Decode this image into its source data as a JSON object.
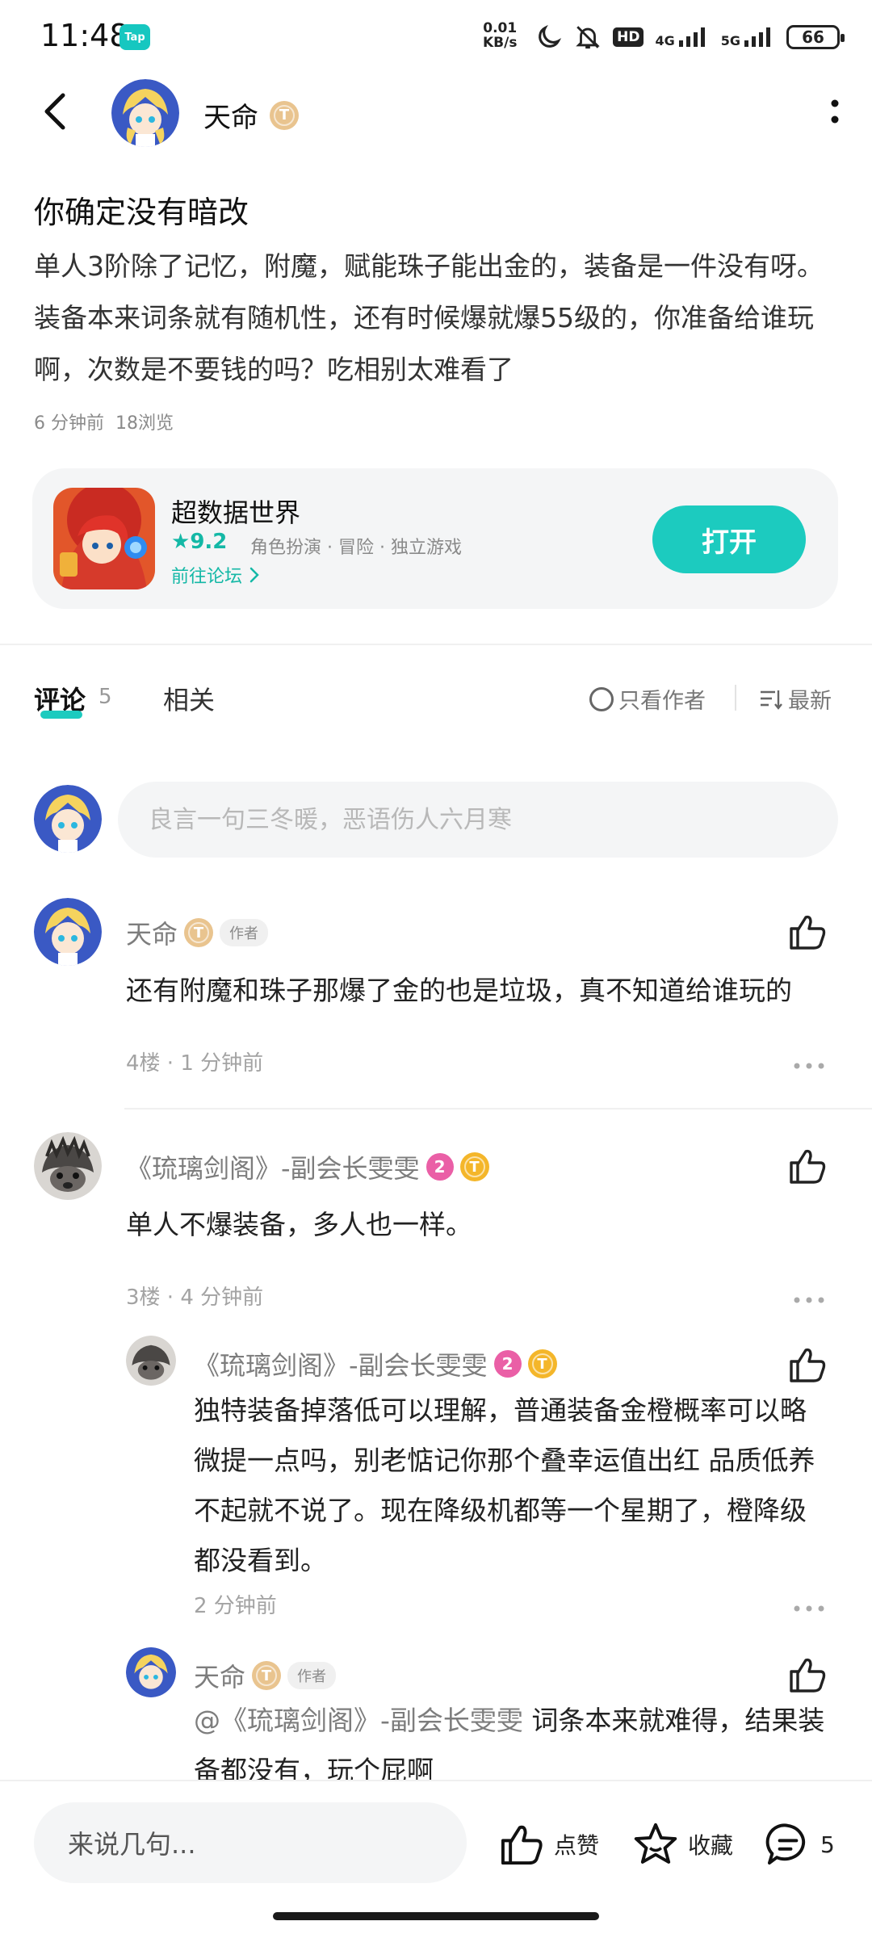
{
  "status_bar": {
    "time": "11:48",
    "app_badge": "Tap",
    "net_speed_value": "0.01",
    "net_speed_unit": "KB/s",
    "hd_label": "HD",
    "signal1": "4G",
    "signal2": "5G",
    "battery": "66"
  },
  "header": {
    "username": "天命",
    "level_badge": "T"
  },
  "post": {
    "title": "你确定没有暗改",
    "body": "单人3阶除了记忆，附魔，赋能珠子能出金的，装备是一件没有呀。装备本来词条就有随机性，还有时候爆就爆55级的，你准备给谁玩啊，次数是不要钱的吗？吃相别太难看了",
    "time": "6 分钟前",
    "views": "18浏览"
  },
  "game_card": {
    "name": "超数据世界",
    "rating": "9.2",
    "tags": "角色扮演 · 冒险 · 独立游戏",
    "forum_link": "前往论坛",
    "open_label": "打开"
  },
  "tabs": {
    "comments_label": "评论",
    "comments_count": "5",
    "related_label": "相关",
    "author_only_label": "只看作者",
    "sort_label": "最新"
  },
  "comment_input": {
    "placeholder": "良言一句三冬暖，恶语伤人六月寒"
  },
  "comments": [
    {
      "name": "天命",
      "badge": "T",
      "author_tag": "作者",
      "text": "还有附魔和珠子那爆了金的也是垃圾，真不知道给谁玩的",
      "meta": "4楼 · 1 分钟前"
    },
    {
      "name": "《琉璃剑阁》-副会长雯雯",
      "v_badge": "2",
      "badge": "T",
      "text": "单人不爆装备，多人也一样。",
      "meta": "3楼 · 4 分钟前",
      "replies": [
        {
          "name": "《琉璃剑阁》-副会长雯雯",
          "v_badge": "2",
          "badge": "T",
          "text": "独特装备掉落低可以理解，普通装备金橙概率可以略微提一点吗，别老惦记你那个叠幸运值出红 品质低养不起就不说了。现在降级机都等一个星期了，橙降级都没看到。",
          "meta": "2 分钟前"
        },
        {
          "name": "天命",
          "badge": "T",
          "author_tag": "作者",
          "mention": "@《琉璃剑阁》-副会长雯雯",
          "text": " 词条本来就难得，结果装备都没有，玩个屁啊"
        }
      ]
    }
  ],
  "bottom_bar": {
    "input_placeholder": "来说几句...",
    "like_label": "点赞",
    "favorite_label": "收藏",
    "comment_count": "5"
  }
}
